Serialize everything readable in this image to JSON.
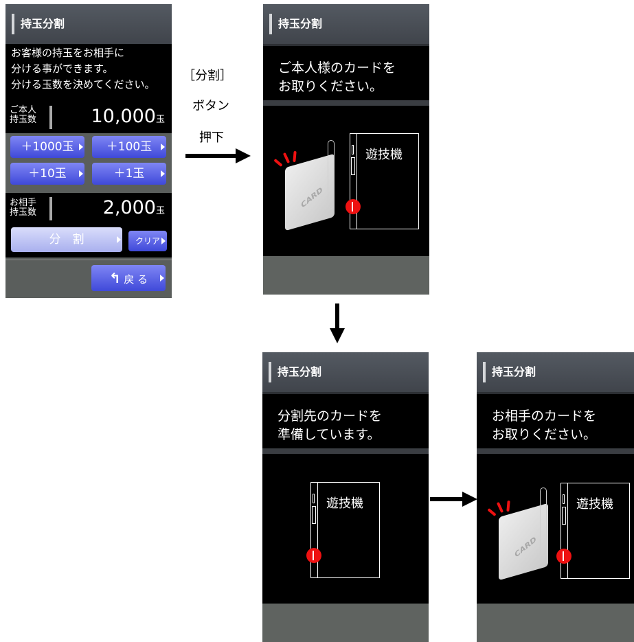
{
  "title": "持玉分割",
  "screen1": {
    "instruction": "お客様の持玉をお相手に\n分ける事ができます。\n分ける玉数を決めてください。",
    "self_label": "ご本人\n持玉数",
    "self_value": "10,000",
    "unit": "玉",
    "btn_1000": "＋1000玉",
    "btn_100": "＋100玉",
    "btn_10": "＋10玉",
    "btn_1": "＋1玉",
    "partner_label": "お相手\n持玉数",
    "partner_value": "2,000",
    "split_button": "分　割",
    "clear_button": "クリア",
    "back_button": "戻 る"
  },
  "note": {
    "line1": "［分割］",
    "line2": "ボタン",
    "line3": "押下"
  },
  "screen2": {
    "message": "ご本人様のカードを\nお取りください。",
    "machine_label": "遊技機",
    "card_text": "CARD"
  },
  "screen3": {
    "message": "分割先のカードを\n準備しています。",
    "machine_label": "遊技機"
  },
  "screen4": {
    "message": "お相手のカードを\nお取りください。",
    "machine_label": "遊技機",
    "card_text": "CARD"
  }
}
